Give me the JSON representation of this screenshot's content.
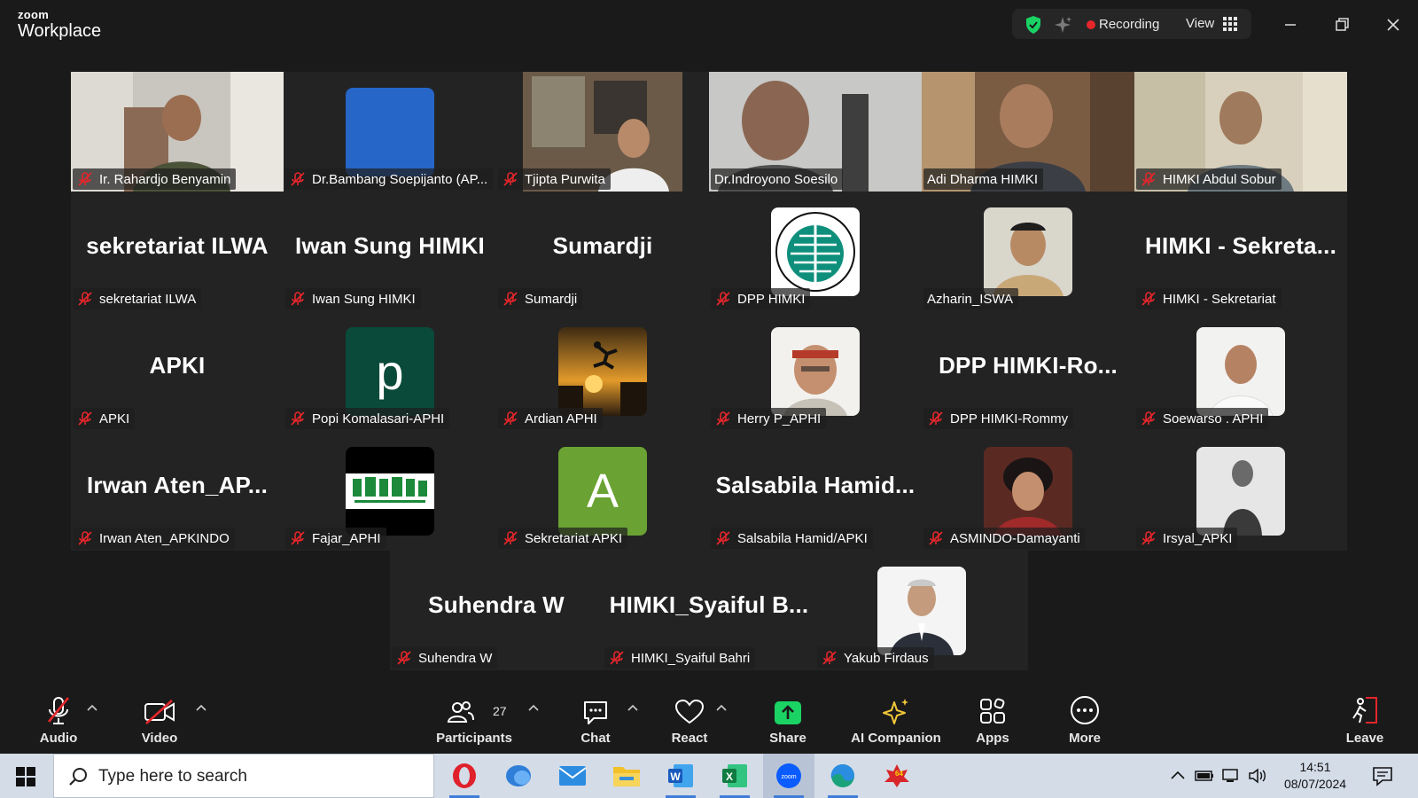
{
  "app": {
    "brand_top": "zoom",
    "brand_bottom": "Workplace"
  },
  "titlebar": {
    "recording_label": "Recording",
    "view_label": "View"
  },
  "tiles": [
    {
      "name": "Ir. Rahardjo Benyamin",
      "big": ""
    },
    {
      "name": "Dr.Bambang Soepijanto (AP...",
      "big": ""
    },
    {
      "name": "Tjipta Purwita",
      "big": ""
    },
    {
      "name": "Dr.Indroyono Soesilo",
      "big": ""
    },
    {
      "name": "Adi Dharma HIMKI",
      "big": ""
    },
    {
      "name": "HIMKI Abdul Sobur",
      "big": ""
    },
    {
      "name": "sekretariat ILWA",
      "big": "sekretariat ILWA"
    },
    {
      "name": "Iwan Sung HIMKI",
      "big": "Iwan Sung HIMKI"
    },
    {
      "name": "Sumardji",
      "big": "Sumardji"
    },
    {
      "name": "DPP HIMKI",
      "big": ""
    },
    {
      "name": "Azharin_ISWA",
      "big": ""
    },
    {
      "name": "HIMKI - Sekretariat",
      "big": "HIMKI - Sekreta..."
    },
    {
      "name": "APKI",
      "big": "APKI"
    },
    {
      "name": "Popi Komalasari-APHI",
      "big": "",
      "letter": "p"
    },
    {
      "name": "Ardian APHI",
      "big": ""
    },
    {
      "name": "Herry P_APHI",
      "big": ""
    },
    {
      "name": "DPP HIMKI-Rommy",
      "big": "DPP HIMKI-Ro..."
    },
    {
      "name": "Soewarso . APHI",
      "big": ""
    },
    {
      "name": "Irwan Aten_APKINDO",
      "big": "Irwan Aten_AP..."
    },
    {
      "name": "Fajar_APHI",
      "big": ""
    },
    {
      "name": "Sekretariat APKI",
      "big": "",
      "letter": "A"
    },
    {
      "name": "Salsabila Hamid/APKI",
      "big": "Salsabila Hamid..."
    },
    {
      "name": "ASMINDO-Damayanti",
      "big": ""
    },
    {
      "name": "Irsyal_APKI",
      "big": ""
    },
    {
      "name": "Suhendra W",
      "big": "Suhendra W"
    },
    {
      "name": "HIMKI_Syaiful Bahri",
      "big": "HIMKI_Syaiful B..."
    },
    {
      "name": "Yakub Firdaus",
      "big": ""
    }
  ],
  "controls": {
    "audio": "Audio",
    "video": "Video",
    "participants": "Participants",
    "participants_count": "27",
    "chat": "Chat",
    "react": "React",
    "share": "Share",
    "ai_companion": "AI Companion",
    "apps": "Apps",
    "more": "More",
    "leave": "Leave"
  },
  "taskbar": {
    "search_placeholder": "Type here to search",
    "time": "14:51",
    "date": "08/07/2024",
    "edge_badge": "64"
  },
  "colors": {
    "active_speaker": "#1ad364",
    "share_green": "#1ad364",
    "recording_red": "#e5262b",
    "mic_muted_red": "#e5262b"
  }
}
